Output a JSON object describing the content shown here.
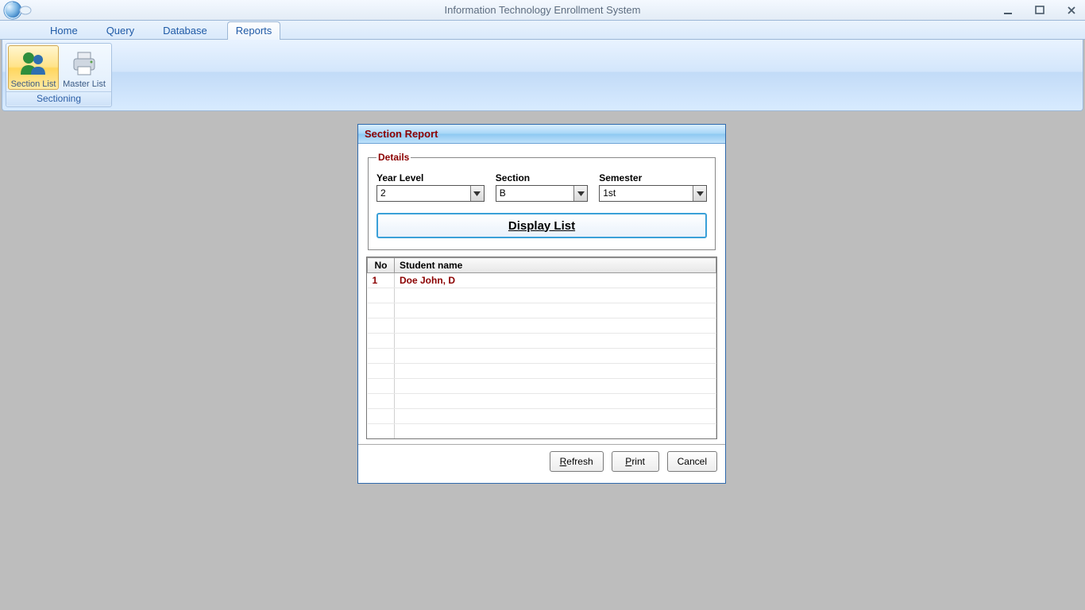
{
  "window": {
    "title": "Information Technology Enrollment System"
  },
  "tabs": {
    "items": [
      "Home",
      "Query",
      "Database",
      "Reports"
    ],
    "active_index": 3
  },
  "ribbon": {
    "group_label": "Sectioning",
    "section_list_label": "Section List",
    "master_list_label": "Master List"
  },
  "dialog": {
    "title": "Section Report",
    "details_legend": "Details",
    "year_level_label": "Year Level",
    "year_level_value": "2",
    "section_label": "Section",
    "section_value": "B",
    "semester_label": "Semester",
    "semester_value": "1st",
    "display_button": "Display List",
    "columns": {
      "no": "No",
      "student": "Student name"
    },
    "rows": [
      {
        "no": "1",
        "student": "Doe John, D"
      }
    ],
    "footer": {
      "refresh": "Refresh",
      "print": "Print",
      "cancel": "Cancel"
    }
  }
}
